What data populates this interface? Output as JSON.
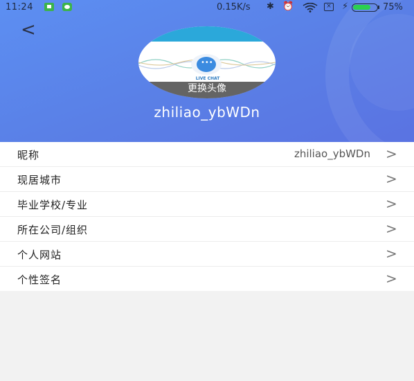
{
  "status_bar": {
    "time": "11:24",
    "speed": "0.15K/s",
    "battery_pct": "75%",
    "battery_level": 0.75
  },
  "header": {
    "back_icon": "chevron-left-icon",
    "avatar_change_label": "更换头像",
    "avatar_caption": "LIVE CHAT",
    "username": "zhiliao_ybWDn"
  },
  "profile_items": [
    {
      "label": "昵称",
      "value": "zhiliao_ybWDn"
    },
    {
      "label": "现居城市",
      "value": ""
    },
    {
      "label": "毕业学校/专业",
      "value": ""
    },
    {
      "label": "所在公司/组织",
      "value": ""
    },
    {
      "label": "个人网站",
      "value": ""
    },
    {
      "label": "个性签名",
      "value": ""
    }
  ],
  "arrow_glyph": ">"
}
